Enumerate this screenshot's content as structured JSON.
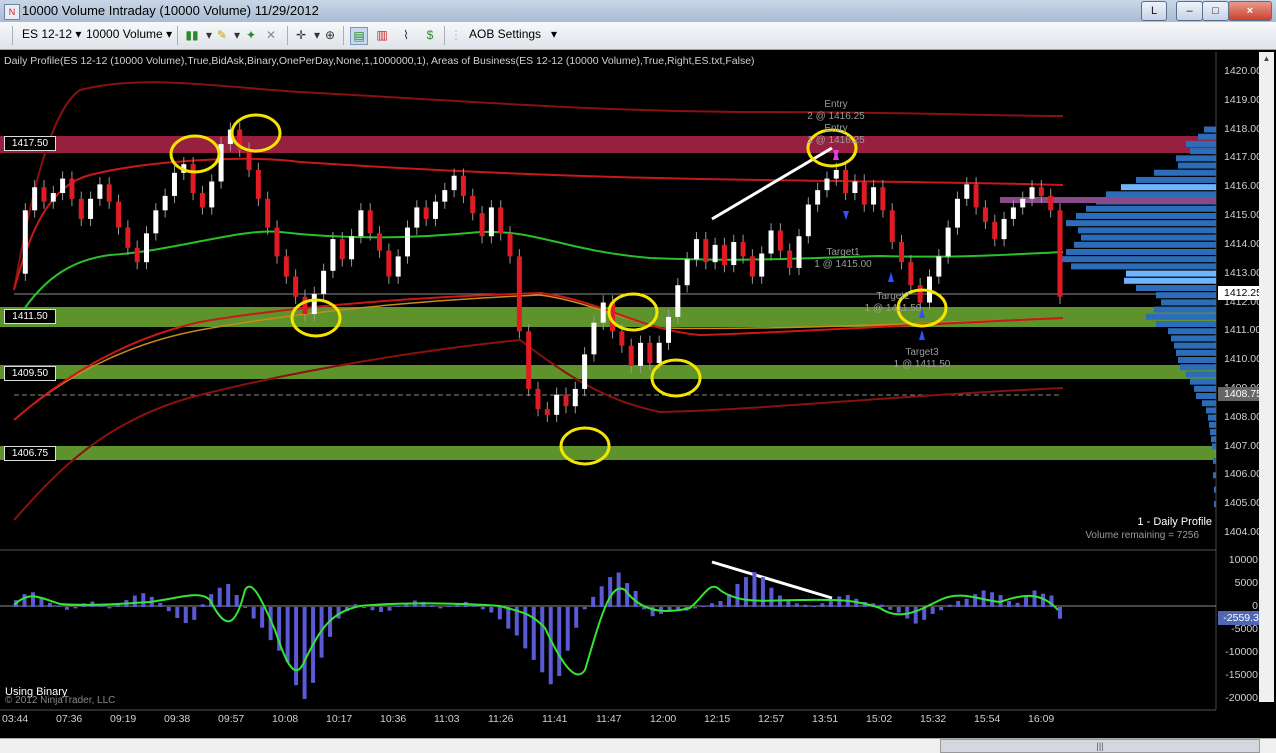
{
  "window": {
    "title": "10000 Volume Intraday (10000 Volume)  11/29/2012",
    "app_icon": "ninjatrader-icon",
    "buttons": [
      "L",
      "–",
      "□",
      "×"
    ]
  },
  "toolbar": {
    "instrument": "ES 12-12",
    "bar_type": "10000 Volume",
    "aob_settings": "AOB Settings",
    "icons": [
      "bar-type-icon",
      "pencil-icon",
      "draw-tool-icon",
      "eraser-icon",
      "crosshair-icon",
      "zoom-icon",
      "data-box-icon",
      "chart-properties-icon",
      "strategy-icon",
      "dollar-icon"
    ]
  },
  "chart": {
    "indicator_label": "Daily Profile(ES 12-12 (10000 Volume),True,BidAsk,Binary,OnePerDay,None,1,1000000,1), Areas of Business(ES 12-12 (10000 Volume),True,Right,ES.txt,False)",
    "profile_title": "1 - Daily Profile",
    "volume_remaining": "Volume remaining = 7256",
    "using_binary": "Using Binary",
    "copyright": "© 2012 NinjaTrader, LLC",
    "price_axis": [
      "1420.00",
      "1419.00",
      "1418.00",
      "1417.00",
      "1416.00",
      "1415.00",
      "1414.00",
      "1413.00",
      "1412.00",
      "1411.00",
      "1410.00",
      "1409.00",
      "1408.00",
      "1407.00",
      "1406.00",
      "1405.00",
      "1404.00"
    ],
    "current_price": "1412.25",
    "poc_price": "1408.75",
    "level_labels": [
      "1417.50",
      "1411.50",
      "1409.50",
      "1406.75"
    ],
    "annotations": [
      {
        "lines": [
          "Entry",
          "2 @ 1416.25"
        ],
        "color": "#9a9a9a"
      },
      {
        "lines": [
          "Entry",
          "1 @ 1416.25"
        ],
        "color": "#9a9a9a"
      },
      {
        "lines": [
          "Target1",
          "1 @ 1415.00"
        ],
        "color": "#9a9a9a"
      },
      {
        "lines": [
          "Target2",
          "1 @ 1411.50"
        ],
        "color": "#9a9a9a"
      },
      {
        "lines": [
          "Target3",
          "1 @ 1411.50"
        ],
        "color": "#9a9a9a"
      }
    ],
    "time_axis": [
      "03:44",
      "07:36",
      "09:19",
      "09:38",
      "09:57",
      "10:08",
      "10:17",
      "10:36",
      "11:03",
      "11:26",
      "11:41",
      "11:47",
      "12:00",
      "12:15",
      "12:57",
      "13:51",
      "15:02",
      "15:32",
      "15:54",
      "16:09"
    ],
    "osc_axis": [
      "10000",
      "5000",
      "0",
      "-5000",
      "-10000",
      "-15000",
      "-20000"
    ],
    "osc_value": "-2559.33",
    "colors": {
      "up_candle": "#ffffff",
      "down_candle": "#e01b24",
      "green_zone": "#7ec43a",
      "red_zone": "#b3264a",
      "profile": "#2d6db8",
      "osc_hist": "#5a5ad6",
      "osc_line": "#33e633",
      "price_tag": "#4f67b5"
    }
  }
}
